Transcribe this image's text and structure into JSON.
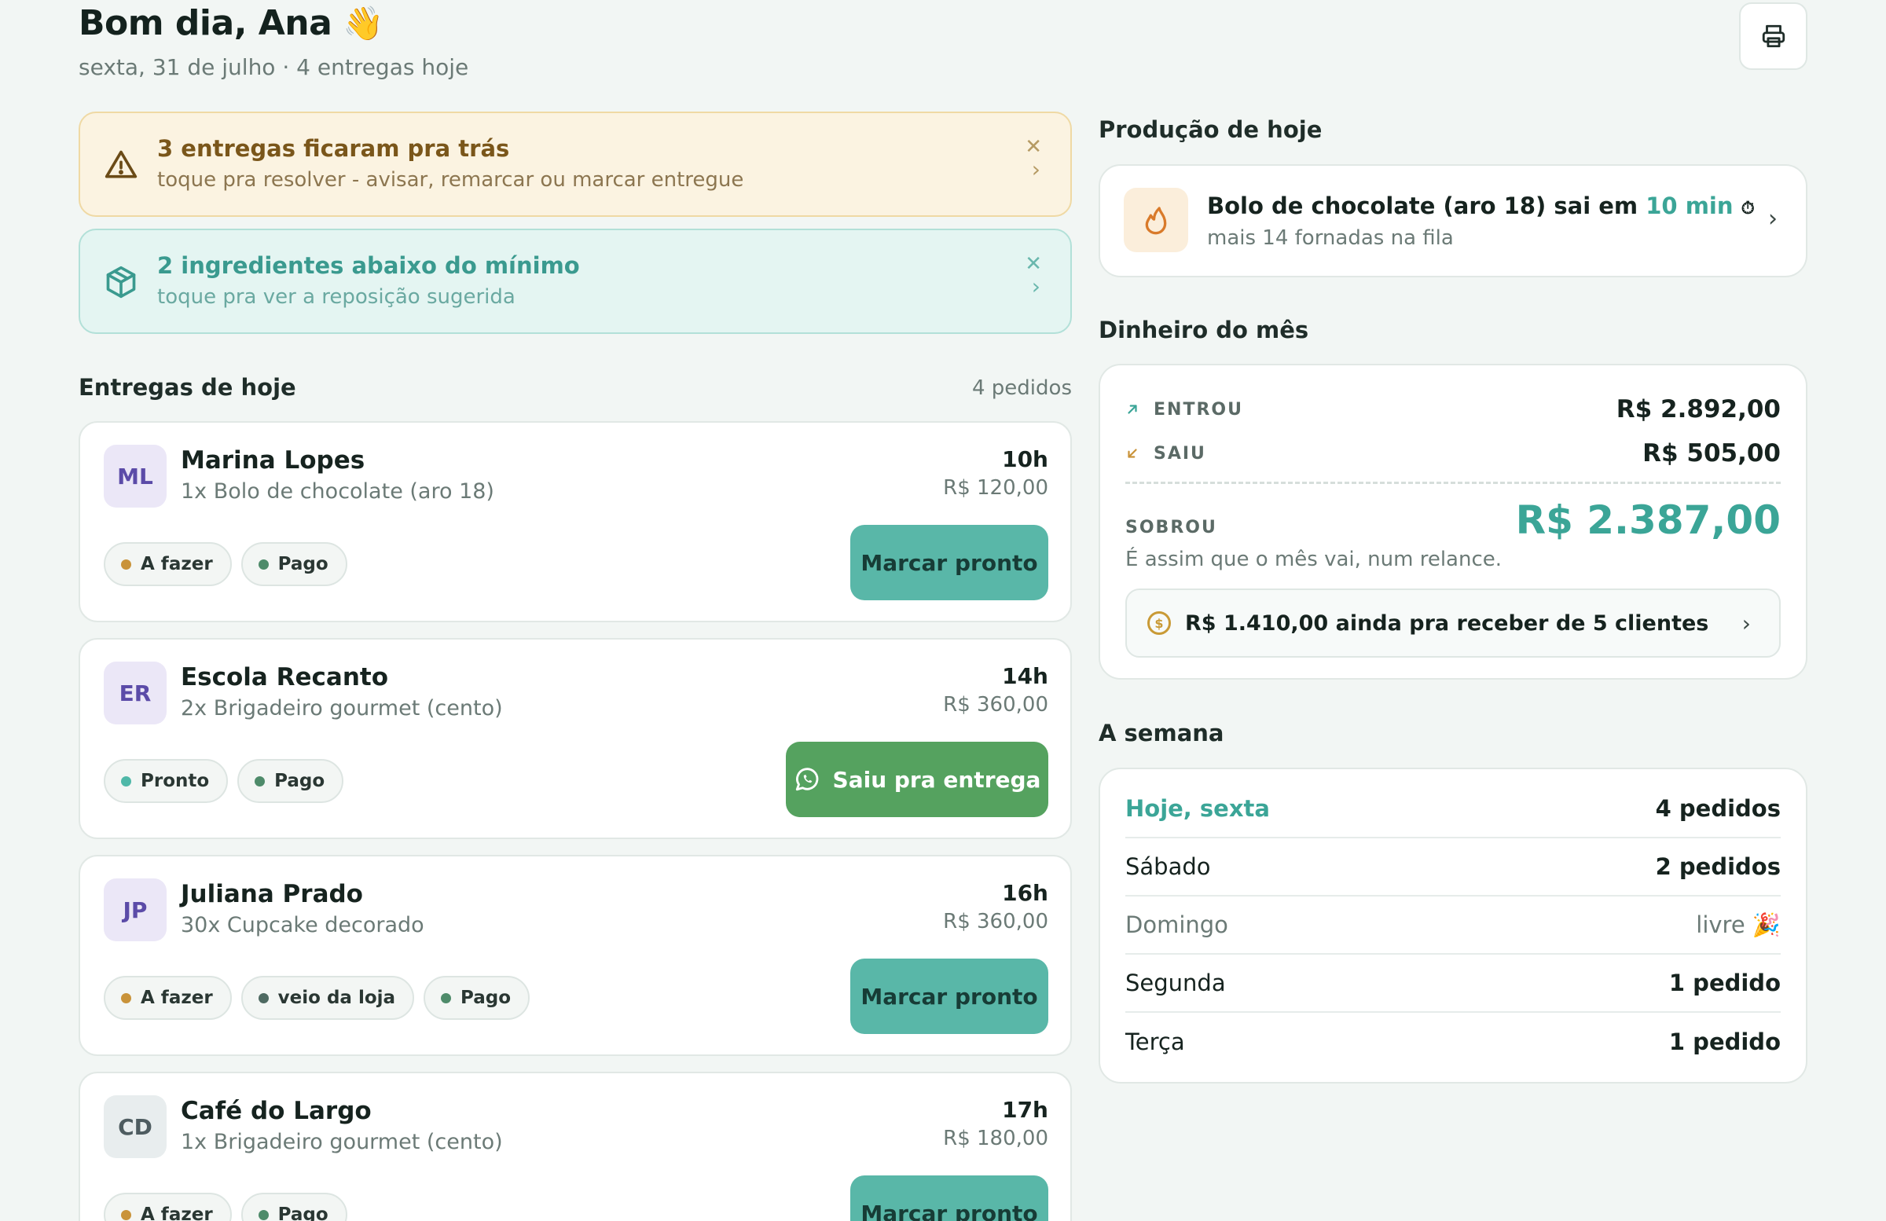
{
  "header": {
    "greeting": "Bom dia, Ana",
    "wave": "👋",
    "subline": "sexta, 31 de julho · 4 entregas hoje",
    "print_icon": "printer-icon"
  },
  "alerts": [
    {
      "title": "3 entregas ficaram pra trás",
      "subtitle": "toque pra resolver - avisar, remarcar ou marcar entregue",
      "icon": "warning-triangle-icon",
      "close": "✕",
      "chevron": "›"
    },
    {
      "title": "2 ingredientes abaixo do mínimo",
      "subtitle": "toque pra ver a reposição sugerida",
      "icon": "box-icon",
      "close": "✕",
      "chevron": "›"
    }
  ],
  "deliveries": {
    "title": "Entregas de hoje",
    "count": "4 pedidos",
    "orders": [
      {
        "initials": "ML",
        "name": "Marina Lopes",
        "item": "1x Bolo de chocolate (aro 18)",
        "time": "10h",
        "price": "R$ 120,00",
        "tags": [
          {
            "label": "A fazer",
            "color": "#c9933a"
          },
          {
            "label": "Pago",
            "color": "#4e8b6a"
          }
        ],
        "action": "Marcar pronto",
        "action_type": "ready"
      },
      {
        "initials": "ER",
        "name": "Escola Recanto",
        "item": "2x Brigadeiro gourmet (cento)",
        "time": "14h",
        "price": "R$ 360,00",
        "tags": [
          {
            "label": "Pronto",
            "color": "#4fb8a8"
          },
          {
            "label": "Pago",
            "color": "#4e8b6a"
          }
        ],
        "action": "Saiu pra entrega",
        "action_type": "whatsapp"
      },
      {
        "initials": "JP",
        "name": "Juliana Prado",
        "item": "30x Cupcake decorado",
        "time": "16h",
        "price": "R$ 360,00",
        "tags": [
          {
            "label": "A fazer",
            "color": "#c9933a"
          },
          {
            "label": "veio da loja",
            "color": "#4e6a62"
          },
          {
            "label": "Pago",
            "color": "#4e8b6a"
          }
        ],
        "action": "Marcar pronto",
        "action_type": "ready"
      },
      {
        "initials": "CD",
        "name": "Café do Largo",
        "item": "1x Brigadeiro gourmet (cento)",
        "time": "17h",
        "price": "R$ 180,00",
        "tags": [
          {
            "label": "A fazer",
            "color": "#c9933a"
          },
          {
            "label": "Pago",
            "color": "#4e8b6a"
          }
        ],
        "action": "Marcar pronto",
        "action_type": "ready"
      }
    ]
  },
  "production": {
    "title": "Produção de hoje",
    "item_prefix": "Bolo de chocolate (aro 18) sai em",
    "item_time": "10 min",
    "timer_glyph": "⏱",
    "subtitle": "mais 14 fornadas na fila",
    "icon": "flame-icon"
  },
  "money": {
    "title": "Dinheiro do mês",
    "in_label": "ENTROU",
    "in_value": "R$ 2.892,00",
    "out_label": "SAIU",
    "out_value": "R$ 505,00",
    "left_label": "SOBROU",
    "left_value": "R$ 2.387,00",
    "note": "É assim que o mês vai, num relance.",
    "receivable": "R$ 1.410,00 ainda pra receber de 5 clientes",
    "coin_glyph": "$"
  },
  "week": {
    "title": "A semana",
    "days": [
      {
        "day": "Hoje, sexta",
        "value": "4 pedidos",
        "kind": "today"
      },
      {
        "day": "Sábado",
        "value": "2 pedidos",
        "kind": "normal"
      },
      {
        "day": "Domingo",
        "value": "livre 🎉",
        "kind": "free"
      },
      {
        "day": "Segunda",
        "value": "1 pedido",
        "kind": "normal"
      },
      {
        "day": "Terça",
        "value": "1 pedido",
        "kind": "normal"
      }
    ]
  },
  "colors": {
    "accent": "#3ba597",
    "ready_button": "#59b7a8",
    "whatsapp_button": "#55a25f",
    "warn_bg": "#fbf3e1",
    "info_bg": "#e4f5f2"
  }
}
